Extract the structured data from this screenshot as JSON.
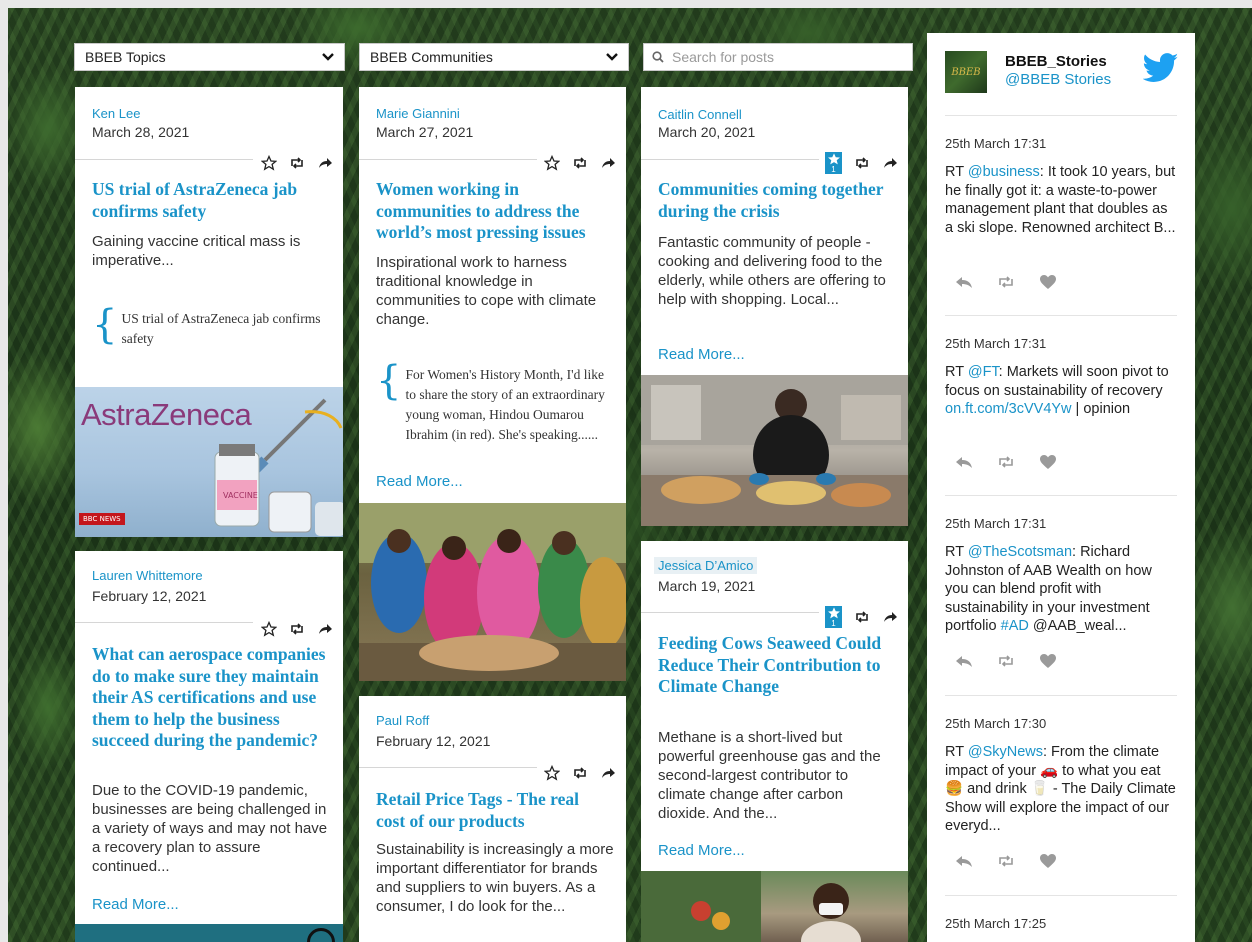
{
  "filters": {
    "topics_label": "BBEB Topics",
    "communities_label": "BBEB Communities",
    "search_placeholder": "Search for posts"
  },
  "posts": [
    {
      "author": "Ken Lee",
      "date": "March 28, 2021",
      "title": "US trial of AstraZeneca jab confirms safety",
      "excerpt": "Gaining vaccine critical mass is imperative...",
      "quote": "US trial of AstraZeneca jab confirms safety",
      "image_caption": "AstraZeneca",
      "image_badge": "BBC NEWS"
    },
    {
      "author": "Lauren Whittemore",
      "date": "February 12, 2021",
      "title": "What can aerospace companies do to make sure they maintain their AS certifications and use them to help the business succeed during the pandemic?",
      "excerpt": "Due to the COVID-19 pandemic, businesses are being challenged in a variety of ways and may not have a recovery plan to assure continued...",
      "read_more": "Read More..."
    },
    {
      "author": "Marie Giannini",
      "date": "March 27, 2021",
      "title": "Women working in communities to address the world’s most pressing issues",
      "excerpt": "Inspirational work to harness traditional knowledge in communities to cope with climate change.",
      "quote": "For Women's History Month, I'd like to share the story of an extraordinary young woman, Hindou Oumarou Ibrahim (in red). She's speaking......",
      "read_more": "Read More..."
    },
    {
      "author": "Paul Roff",
      "date": "February 12, 2021",
      "title": "Retail Price Tags - The real cost of our products",
      "excerpt": "Sustainability is increasingly a more important differentiator for brands and suppliers to win buyers. As a consumer, I do look for the..."
    },
    {
      "author": "Caitlin Connell",
      "date": "March 20, 2021",
      "star_count": "1",
      "title": "Communities coming together during the crisis",
      "excerpt": "Fantastic community of people - cooking and delivering food to the elderly, while others are offering to help with shopping. Local...",
      "read_more": "Read More..."
    },
    {
      "author": "Jessica D’Amico",
      "date": "March 19, 2021",
      "star_count": "1",
      "title": "Feeding Cows Seaweed Could Reduce Their Contribution to Climate Change",
      "excerpt": "Methane is a short-lived but powerful greenhouse gas and the second-largest contributor to climate change after carbon dioxide. And the...",
      "read_more": "Read More..."
    }
  ],
  "twitter": {
    "name": "BBEB_Stories",
    "handle": "@BBEB Stories",
    "avatar_text": "BBEB",
    "tweets": [
      {
        "time": "25th March 17:31",
        "prefix": "RT ",
        "mention": "@business",
        "text": ": It took 10 years, but he finally got it: a waste-to-power management plant that doubles as a ski slope. Renowned architect B..."
      },
      {
        "time": "25th March 17:31",
        "prefix": "RT ",
        "mention": "@FT",
        "text": ": Markets will soon pivot to focus on sustainability of recovery ",
        "link": "on.ft.com/3cVV4Yw",
        "suffix": " | opinion"
      },
      {
        "time": "25th March 17:31",
        "prefix": "RT ",
        "mention": "@TheScotsman",
        "text": ": Richard Johnston of AAB Wealth on how you can blend profit with sustainability in your investment portfolio ",
        "link": "#AD",
        "suffix": " @AAB_weal..."
      },
      {
        "time": "25th March 17:30",
        "prefix": "RT ",
        "mention": "@SkyNews",
        "text": ": From the climate impact of your 🚗 to what you eat 🍔 and drink 🥛 - The Daily Climate Show will explore the impact of our everyd..."
      },
      {
        "time": "25th March 17:25"
      }
    ]
  },
  "colors": {
    "accent": "#1a93c8",
    "card_bg": "#ffffff"
  }
}
